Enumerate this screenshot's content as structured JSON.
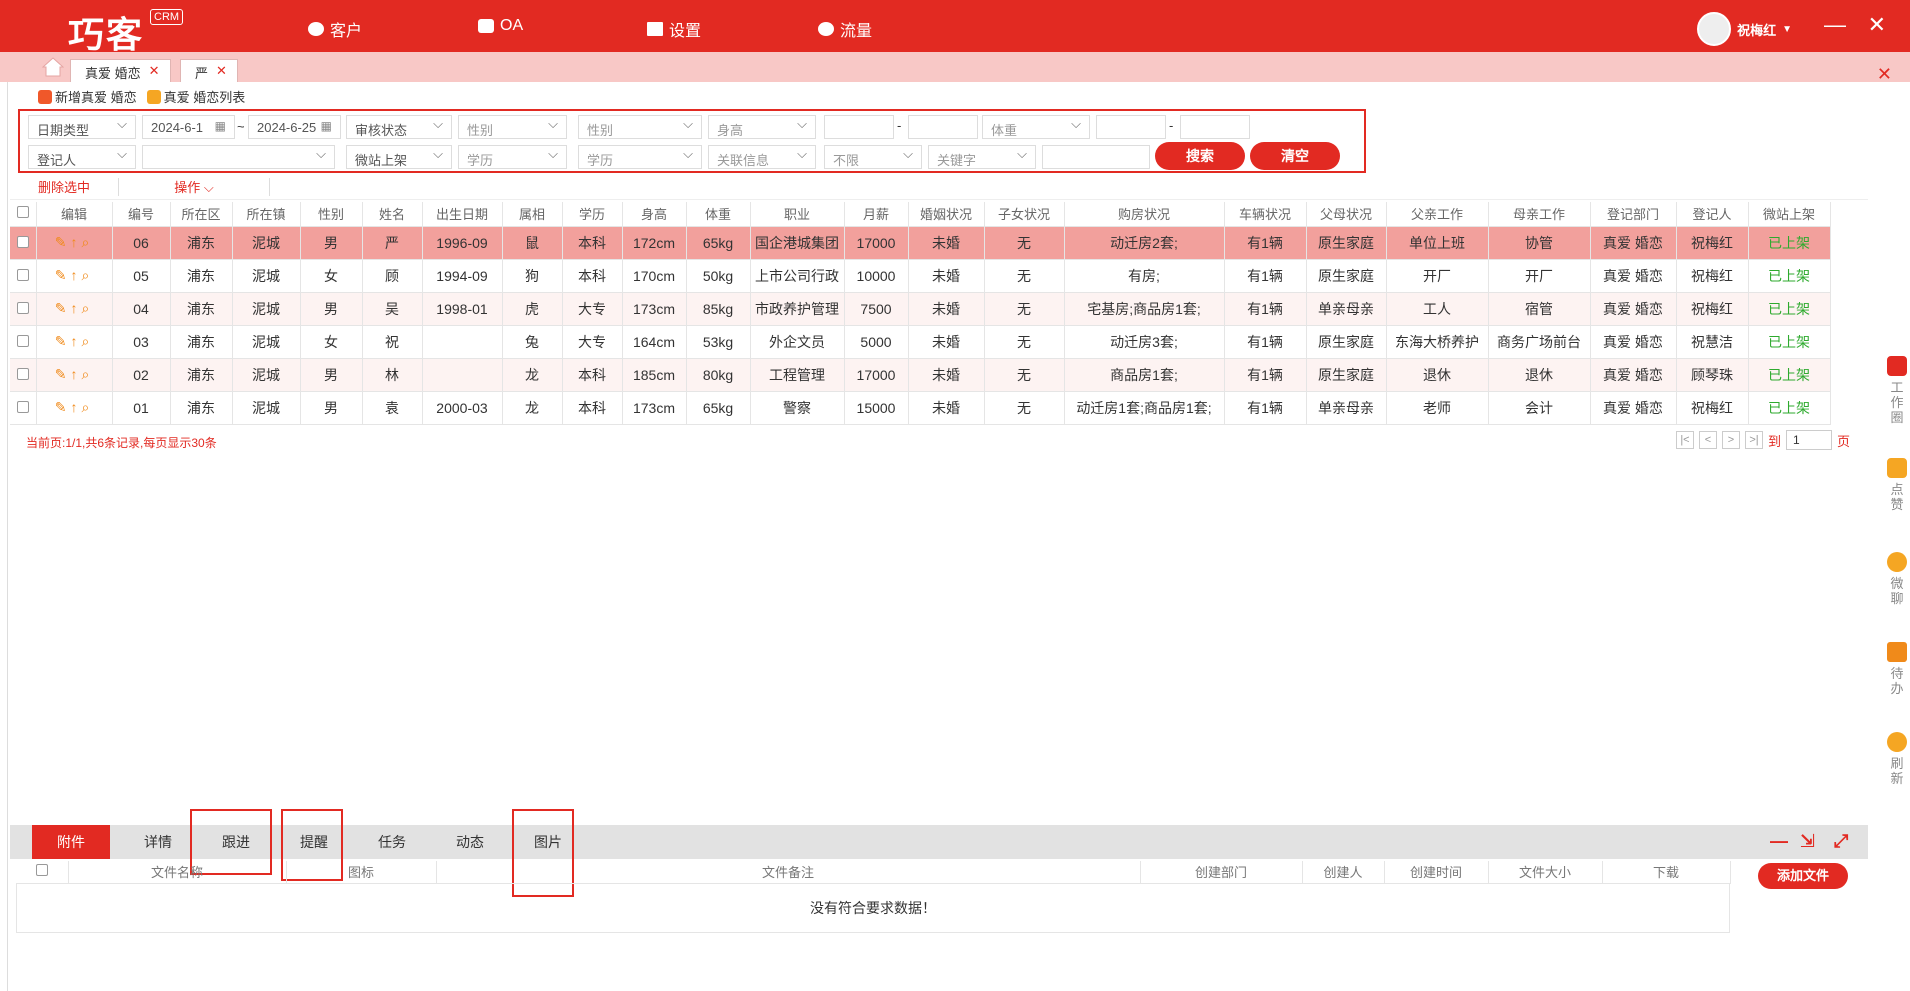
{
  "app": {
    "logo": "巧客",
    "badge": "CRM",
    "nav": [
      "客户",
      "OA",
      "设置",
      "流量"
    ],
    "user": "祝梅红"
  },
  "tabs": [
    {
      "label": "真爱 婚恋"
    },
    {
      "label": "严"
    }
  ],
  "actions": {
    "add": "新增真爱 婚恋",
    "list": "真爱 婚恋列表"
  },
  "filters": {
    "date_type": "日期类型",
    "date_from": "2024-6-1",
    "tilde": "~",
    "date_to": "2024-6-25",
    "audit": "审核状态",
    "gender1": "性别",
    "gender2": "性别",
    "height": "身高",
    "weight": "体重",
    "dash": "-",
    "registrar": "登记人",
    "micro": "微站上架",
    "edu1": "学历",
    "edu2": "学历",
    "relation": "关联信息",
    "unlimited": "不限",
    "keyword": "关键字",
    "search": "搜索",
    "clear": "清空"
  },
  "toolbar": {
    "delete_selected": "删除选中",
    "operate": "操作"
  },
  "table": {
    "headers": [
      "编辑",
      "编号",
      "所在区",
      "所在镇",
      "性别",
      "姓名",
      "出生日期",
      "属相",
      "学历",
      "身高",
      "体重",
      "职业",
      "月薪",
      "婚姻状况",
      "子女状况",
      "购房状况",
      "车辆状况",
      "父母状况",
      "父亲工作",
      "母亲工作",
      "登记部门",
      "登记人",
      "微站上架"
    ],
    "rows": [
      [
        "06",
        "浦东",
        "泥城",
        "男",
        "严",
        "1996-09",
        "鼠",
        "本科",
        "172cm",
        "65kg",
        "国企港城集团",
        "17000",
        "未婚",
        "无",
        "动迁房2套;",
        "有1辆",
        "原生家庭",
        "单位上班",
        "协管",
        "真爱 婚恋",
        "祝梅红",
        "已上架"
      ],
      [
        "05",
        "浦东",
        "泥城",
        "女",
        "顾",
        "1994-09",
        "狗",
        "本科",
        "170cm",
        "50kg",
        "上市公司行政",
        "10000",
        "未婚",
        "无",
        "有房;",
        "有1辆",
        "原生家庭",
        "开厂",
        "开厂",
        "真爱 婚恋",
        "祝梅红",
        "已上架"
      ],
      [
        "04",
        "浦东",
        "泥城",
        "男",
        "吴",
        "1998-01",
        "虎",
        "大专",
        "173cm",
        "85kg",
        "市政养护管理",
        "7500",
        "未婚",
        "无",
        "宅基房;商品房1套;",
        "有1辆",
        "单亲母亲",
        "工人",
        "宿管",
        "真爱 婚恋",
        "祝梅红",
        "已上架"
      ],
      [
        "03",
        "浦东",
        "泥城",
        "女",
        "祝",
        "",
        "兔",
        "大专",
        "164cm",
        "53kg",
        "外企文员",
        "5000",
        "未婚",
        "无",
        "动迁房3套;",
        "有1辆",
        "原生家庭",
        "东海大桥养护",
        "商务广场前台",
        "真爱 婚恋",
        "祝慧洁",
        "已上架"
      ],
      [
        "02",
        "浦东",
        "泥城",
        "男",
        "林",
        "",
        "龙",
        "本科",
        "185cm",
        "80kg",
        "工程管理",
        "17000",
        "未婚",
        "无",
        "商品房1套;",
        "有1辆",
        "原生家庭",
        "退休",
        "退休",
        "真爱 婚恋",
        "顾琴珠",
        "已上架"
      ],
      [
        "01",
        "浦东",
        "泥城",
        "男",
        "袁",
        "2000-03",
        "龙",
        "本科",
        "173cm",
        "65kg",
        "警察",
        "15000",
        "未婚",
        "无",
        "动迁房1套;商品房1套;",
        "有1辆",
        "单亲母亲",
        "老师",
        "会计",
        "真爱 婚恋",
        "祝梅红",
        "已上架"
      ]
    ]
  },
  "pager": {
    "summary": "当前页:1/1,共6条记录,每页显示30条",
    "goto": "到",
    "page": "1",
    "unit": "页"
  },
  "side": [
    "工作圈",
    "点赞",
    "微聊",
    "待办",
    "刷新"
  ],
  "bottom_tabs": [
    "附件",
    "详情",
    "跟进",
    "提醒",
    "任务",
    "动态",
    "图片"
  ],
  "files": {
    "headers": [
      "文件名称",
      "图标",
      "文件备注",
      "创建部门",
      "创建人",
      "创建时间",
      "文件大小",
      "下载"
    ],
    "empty": "没有符合要求数据！",
    "add": "添加文件"
  },
  "colors": {
    "brand": "#e22a22",
    "tabbar": "#f8c8c6",
    "selected_row": "#f2a09c",
    "status": "#2eaa2e"
  }
}
